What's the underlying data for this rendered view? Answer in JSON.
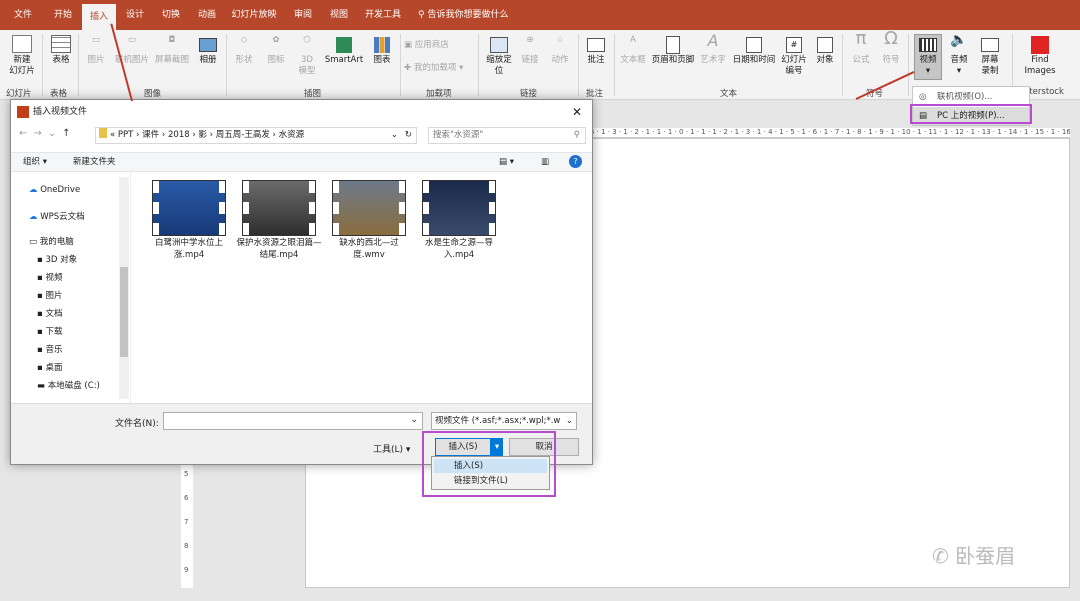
{
  "tabs": [
    "文件",
    "开始",
    "插入",
    "设计",
    "切换",
    "动画",
    "幻灯片放映",
    "审阅",
    "视图",
    "开发工具"
  ],
  "active_tab": "插入",
  "tell_me": "告诉我你想要做什么",
  "ribbon": {
    "new_slide": [
      "新建",
      "幻灯片"
    ],
    "table": "表格",
    "picture": "图片",
    "online_picture": "联机图片",
    "screenshot": "屏幕截图",
    "album": "相册",
    "shapes": "形状",
    "icons": "图标",
    "model": [
      "3D",
      "模型"
    ],
    "smartart": "SmartArt",
    "chart": "图表",
    "store": "应用商店",
    "my_addins": "我的加载项",
    "zoom": [
      "缩放定",
      "位"
    ],
    "link": "链接",
    "action": "动作",
    "comment": "批注",
    "textbox": "文本框",
    "header_footer": "页眉和页脚",
    "wordart": "艺术字",
    "datetime": "日期和时间",
    "slide_number": [
      "幻灯片",
      "编号"
    ],
    "object": "对象",
    "equation": "公式",
    "symbol": "符号",
    "video": "视频",
    "audio": "音频",
    "screen_record": [
      "屏幕",
      "录制"
    ],
    "find_images": [
      "Find",
      "Images"
    ],
    "groups": {
      "slides": "幻灯片",
      "tables": "表格",
      "images": "图像",
      "illustrations": "插图",
      "addins": "加载项",
      "links": "链接",
      "comments": "批注",
      "text": "文本",
      "symbols": "符号",
      "shutterstock": "tterstock"
    }
  },
  "video_menu": [
    "联机视频(O)...",
    "PC 上的视频(P)..."
  ],
  "dialog": {
    "title": "插入视频文件",
    "path": [
      "PPT",
      "课件",
      "2018",
      "影",
      "周五周-王高发",
      "水资源"
    ],
    "search_placeholder": "搜索\"水资源\"",
    "organize": "组织 ▾",
    "new_folder": "新建文件夹",
    "nav": [
      "OneDrive",
      "WPS云文档",
      "我的电脑",
      "3D 对象",
      "视频",
      "图片",
      "文档",
      "下载",
      "音乐",
      "桌面",
      "本地磁盘 (C:)"
    ],
    "files": [
      {
        "name": "白鹭洲中学水位上涨.mp4"
      },
      {
        "name": "保护水资源之眼泪篇—结尾.mp4"
      },
      {
        "name": "缺水的西北—过度.wmv"
      },
      {
        "name": "水是生命之源—导入.mp4"
      }
    ],
    "filename_label": "文件名(N):",
    "filename_value": "",
    "filter": "视频文件 (*.asf;*.asx;*.wpl;*.w",
    "tools": "工具(L)",
    "insert": "插入(S)",
    "cancel": "取消"
  },
  "insert_menu": [
    "插入(S)",
    "链接到文件(L)"
  ],
  "watermark": "卧蚕眉",
  "hruler": "4 · 1 · 3 · 1 · 2 · 1 · 1 · 1 · 0 · 1 · 1 · 1 · 2 · 1 · 3 · 1 · 4 · 1 · 5 · 1 · 6 · 1 · 7 · 1 · 8 · 1 · 9 · 1 · 10 · 1 · 11 · 1 · 12 · 1 · 13 · 1 · 14 · 1 · 15 · 1 · 16",
  "vruler": [
    "5",
    "6",
    "7",
    "8",
    "9"
  ]
}
